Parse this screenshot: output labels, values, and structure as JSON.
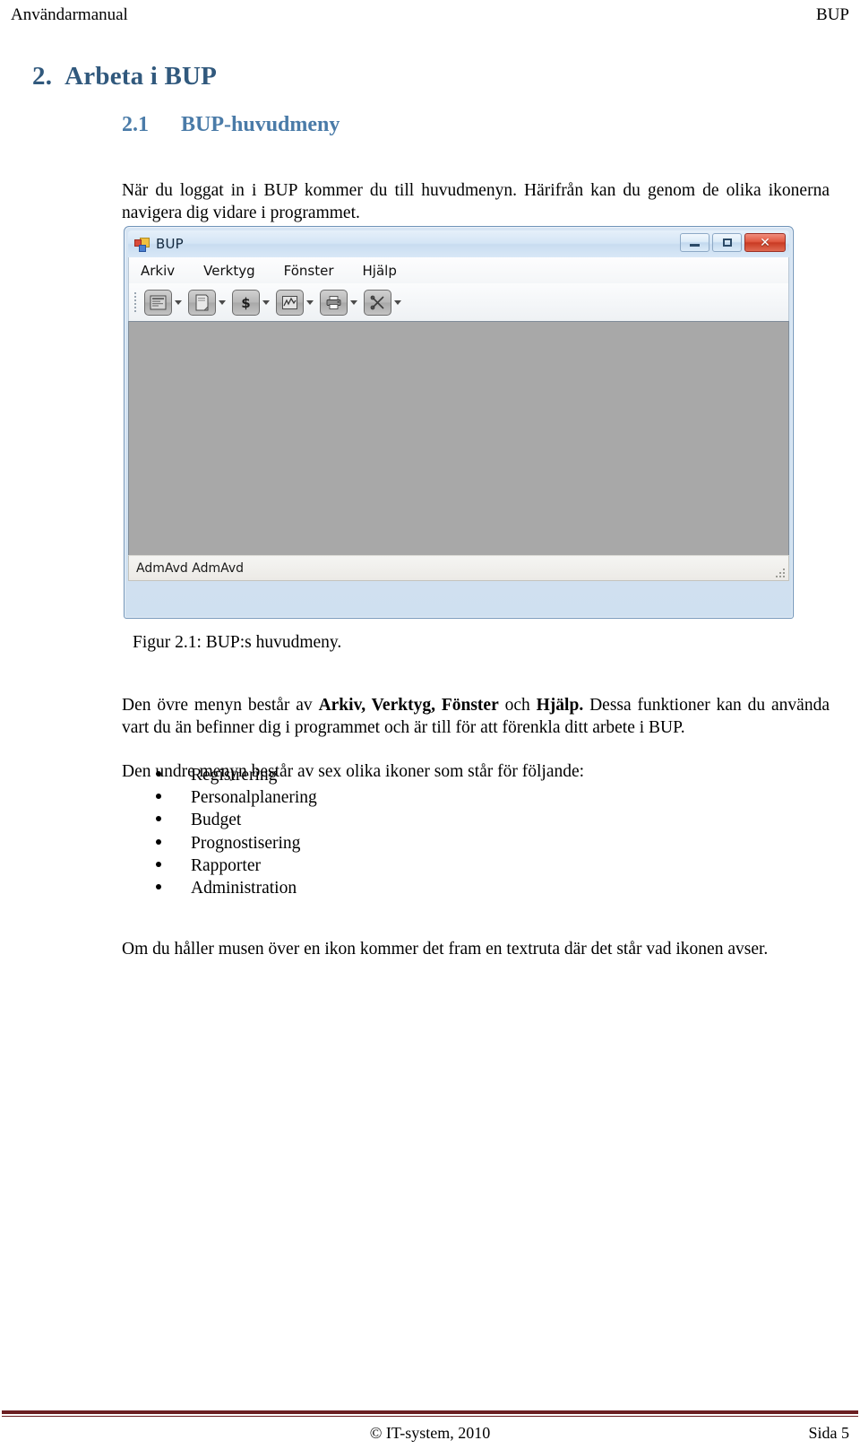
{
  "header": {
    "left": "Användarmanual",
    "right": "BUP"
  },
  "headings": {
    "h1_number": "2.",
    "h1_text": "Arbeta i BUP",
    "h1_color": "#31597d",
    "h2_number": "2.1",
    "h2_text": "BUP-huvudmeny",
    "h2_color": "#4a7ba8"
  },
  "paragraphs": {
    "intro": "När du loggat in i BUP kommer du till huvudmenyn. Härifrån kan du genom de olika ikonerna navigera dig vidare i programmet.",
    "meny_part1": "Den övre menyn består av ",
    "meny_bold1": "Arkiv, Verktyg, Fönster",
    "meny_part2": " och ",
    "meny_bold2": "Hjälp.",
    "meny_part3": " Dessa funktioner kan du använda vart du än befinner dig i programmet och är till för att förenkla ditt arbete i BUP.",
    "undre_meny": "Den undre menyn består av sex olika ikoner som står för följande:",
    "tooltip": "Om du håller musen över en ikon kommer det fram en textruta där det står vad ikonen avser."
  },
  "figure": {
    "caption": "Figur 2.1: BUP:s huvudmeny.",
    "window": {
      "title": "BUP",
      "app_icon": "app-squares-icon",
      "window_buttons": [
        {
          "name": "minimize",
          "icon": "minimize-icon",
          "label": ""
        },
        {
          "name": "maximize",
          "icon": "maximize-icon",
          "label": ""
        },
        {
          "name": "close",
          "icon": "close-icon",
          "label": "✕"
        }
      ],
      "menu_items": [
        "Arkiv",
        "Verktyg",
        "Fönster",
        "Hjälp"
      ],
      "toolbar_buttons": [
        {
          "icon": "registration-form-icon",
          "label": "Registrering"
        },
        {
          "icon": "document-page-icon",
          "label": "Personalplanering"
        },
        {
          "icon": "dollar-sign-icon",
          "label": "Budget"
        },
        {
          "icon": "chart-line-icon",
          "label": "Prognostisering"
        },
        {
          "icon": "printer-icon",
          "label": "Rapporter"
        },
        {
          "icon": "crossed-tools-icon",
          "label": "Administration"
        }
      ],
      "status_text": "AdmAvd AdmAvd",
      "client_color": "#a8a8a8"
    }
  },
  "bullets": [
    "Registrering",
    "Personalplanering",
    "Budget",
    "Prognostisering",
    "Rapporter",
    "Administration"
  ],
  "footer": {
    "center": "© IT-system, 2010",
    "right": "Sida 5",
    "rule_color": "#6b1f22"
  }
}
